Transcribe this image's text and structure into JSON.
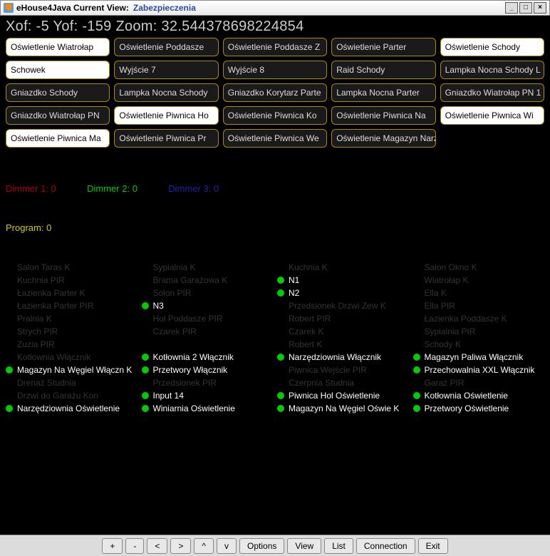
{
  "window": {
    "app_title": "eHouse4Java Current View:",
    "view_name": "Zabezpieczenia"
  },
  "status": {
    "xof_label": "Xof:",
    "xof": "-5",
    "yof_label": "Yof:",
    "yof": "-159",
    "zoom_label": "Zoom:",
    "zoom": "32.544378698224854"
  },
  "buttons": [
    {
      "label": "Oświetlenie Wiatrołap",
      "state": "on"
    },
    {
      "label": "Oświetlenie Poddasze",
      "state": "off"
    },
    {
      "label": "Oświetlenie Poddasze Z",
      "state": "off"
    },
    {
      "label": "Oświetlenie Parter",
      "state": "off"
    },
    {
      "label": "Oświetlenie Schody",
      "state": "on"
    },
    {
      "label": "Schowek",
      "state": "on"
    },
    {
      "label": "Wyjście 7",
      "state": "off"
    },
    {
      "label": "Wyjście 8",
      "state": "off"
    },
    {
      "label": "Raid Schody",
      "state": "off"
    },
    {
      "label": "Lampka Nocna Schody L",
      "state": "off"
    },
    {
      "label": "Gniazdko Schody",
      "state": "off"
    },
    {
      "label": "Lampka Nocna Schody",
      "state": "off"
    },
    {
      "label": "Gniazdko Korytarz Parte",
      "state": "off"
    },
    {
      "label": "Lampka Nocna Parter",
      "state": "off"
    },
    {
      "label": "Gniazdko Wiatrołap PN 1",
      "state": "off"
    },
    {
      "label": "Gniazdko Wiatrołap PN",
      "state": "off"
    },
    {
      "label": "Oświetlenie Piwnica Ho",
      "state": "on"
    },
    {
      "label": "Oświetlenie Piwnica Ko",
      "state": "off"
    },
    {
      "label": "Oświetlenie Piwnica Na",
      "state": "off"
    },
    {
      "label": "Oświetlenie Piwnica Wi",
      "state": "on"
    },
    {
      "label": "Oświetlenie Piwnica Ma",
      "state": "on"
    },
    {
      "label": "Oświetlenie Piwnica Pr",
      "state": "off"
    },
    {
      "label": "Oświetlenie Piwnica We",
      "state": "off"
    },
    {
      "label": "Oświetlenie Magazyn Narzędzia",
      "state": "off"
    }
  ],
  "dimmers": {
    "d1": "Dimmer 1: 0",
    "d2": "Dimmer 2: 0",
    "d3": "Dimmer 3: 0"
  },
  "program": "Program: 0",
  "sensors": [
    [
      {
        "label": "Salon Taras K",
        "on": false,
        "dim": true
      },
      {
        "label": "Kuchnia PIR",
        "on": false,
        "dim": true
      },
      {
        "label": "Łazienka Parter K",
        "on": false,
        "dim": true
      },
      {
        "label": "Łazienka Parter PIR",
        "on": false,
        "dim": true
      },
      {
        "label": "Pralnia K",
        "on": false,
        "dim": true
      },
      {
        "label": "Strych PIR",
        "on": false,
        "dim": true
      },
      {
        "label": "Zuzia PIR",
        "on": false,
        "dim": true
      },
      {
        "label": "Kotłownia Włącznik",
        "on": false,
        "dim": true
      },
      {
        "label": "Magazyn Na Węgiel Włączn  K",
        "on": true,
        "dim": false
      },
      {
        "label": "Drenaż Studnia",
        "on": false,
        "dim": true
      },
      {
        "label": "Drzwi do Garażu Kon",
        "on": false,
        "dim": true
      },
      {
        "label": "Narzędziownia Oświetlenie",
        "on": true,
        "dim": false
      }
    ],
    [
      {
        "label": "Sypialnia K",
        "on": false,
        "dim": true
      },
      {
        "label": "Brama Garażowa K",
        "on": false,
        "dim": true
      },
      {
        "label": "Solon PIR",
        "on": false,
        "dim": true
      },
      {
        "label": "N3",
        "on": true,
        "dim": false
      },
      {
        "label": "Hol Poddasze PIR",
        "on": false,
        "dim": true
      },
      {
        "label": "Czarek PIR",
        "on": false,
        "dim": true
      },
      {
        "label": "",
        "on": false,
        "dim": true
      },
      {
        "label": "Kotłownia 2 Włącznik",
        "on": true,
        "dim": false
      },
      {
        "label": "Przetwory Włącznik",
        "on": true,
        "dim": false
      },
      {
        "label": "Przedsionek PIR",
        "on": false,
        "dim": true
      },
      {
        "label": "Input 14",
        "on": true,
        "dim": false
      },
      {
        "label": "Winiarnia Oświetlenie",
        "on": true,
        "dim": false
      }
    ],
    [
      {
        "label": "Kuchnia K",
        "on": false,
        "dim": true
      },
      {
        "label": "N1",
        "on": true,
        "dim": false
      },
      {
        "label": "N2",
        "on": true,
        "dim": false
      },
      {
        "label": "Przedsionek Drzwi Zew K",
        "on": false,
        "dim": true
      },
      {
        "label": "Robert PIR",
        "on": false,
        "dim": true
      },
      {
        "label": "Czarek K",
        "on": false,
        "dim": true
      },
      {
        "label": "Robert K",
        "on": false,
        "dim": true
      },
      {
        "label": "Narzędziownia Włącznik",
        "on": true,
        "dim": false
      },
      {
        "label": "Piwnica Wejście PIR",
        "on": false,
        "dim": true
      },
      {
        "label": "Czerpnia Studnia",
        "on": false,
        "dim": true
      },
      {
        "label": "Piwnica Hol Oświetlenie",
        "on": true,
        "dim": false
      },
      {
        "label": "Magazyn Na Węgiel Oświe   K",
        "on": true,
        "dim": false
      }
    ],
    [
      {
        "label": "Salon Okno K",
        "on": false,
        "dim": true
      },
      {
        "label": "Wiatrołap K",
        "on": false,
        "dim": true
      },
      {
        "label": "Ella K",
        "on": false,
        "dim": true
      },
      {
        "label": "Ella PIR",
        "on": false,
        "dim": true
      },
      {
        "label": "Łazienka Poddasze K",
        "on": false,
        "dim": true
      },
      {
        "label": "Sypialnia PIR",
        "on": false,
        "dim": true
      },
      {
        "label": "Schody K",
        "on": false,
        "dim": true
      },
      {
        "label": "Magazyn Paliwa Włącznik",
        "on": true,
        "dim": false
      },
      {
        "label": "Przechowalnia XXL Włącznik",
        "on": true,
        "dim": false
      },
      {
        "label": "Garaż PIR",
        "on": false,
        "dim": true
      },
      {
        "label": "Kotłownia Oświetlenie",
        "on": true,
        "dim": false
      },
      {
        "label": "Przetwory Oświetlenie",
        "on": true,
        "dim": false
      }
    ]
  ],
  "bottom_buttons": [
    "+",
    "-",
    "<",
    ">",
    "^",
    "v",
    "Options",
    "View",
    "List",
    "Connection",
    "Exit"
  ]
}
